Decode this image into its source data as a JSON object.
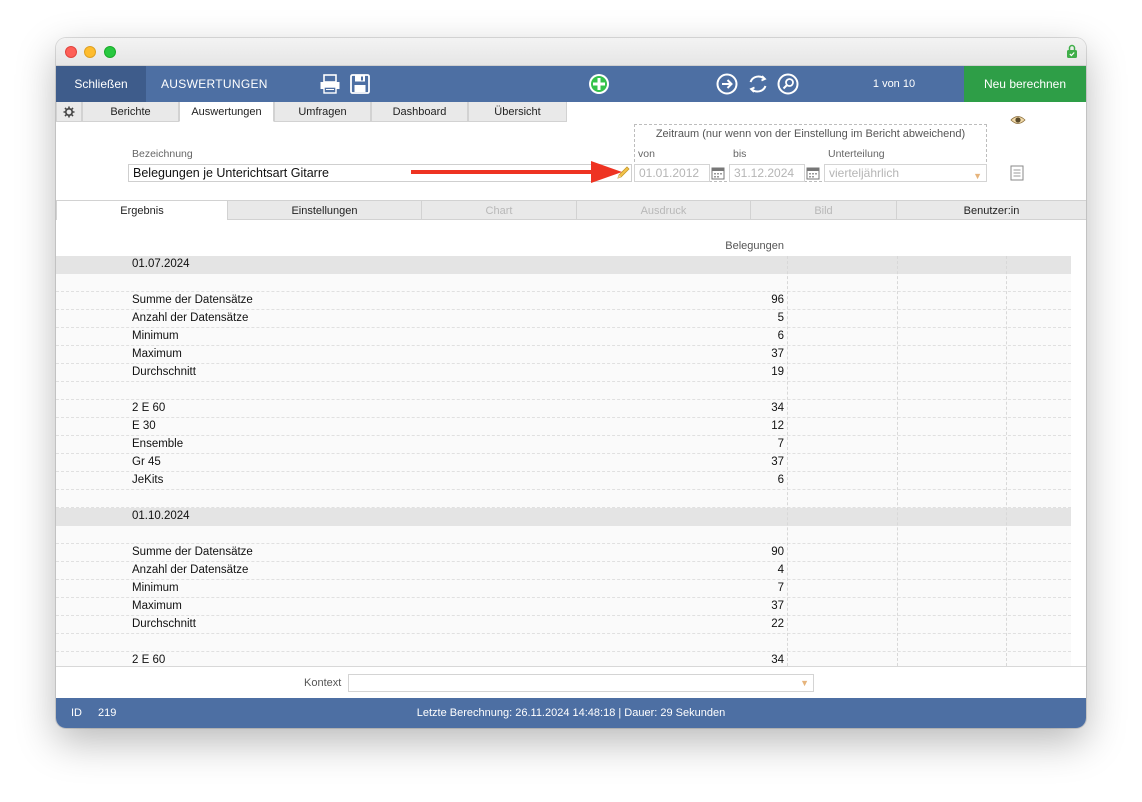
{
  "toolbar": {
    "close_label": "Schließen",
    "title": "AUSWERTUNGEN",
    "record_count": "1 von 10",
    "recalc_label": "Neu berechnen"
  },
  "top_tabs": [
    "Berichte",
    "Auswertungen",
    "Umfragen",
    "Dashboard",
    "Übersicht"
  ],
  "form": {
    "bezeichnung_label": "Bezeichnung",
    "bezeichnung_value": "Belegungen je Unterichtsart Gitarre",
    "zeitraum_label": "Zeitraum (nur wenn von der Einstellung im Bericht abweichend)",
    "von_label": "von",
    "von_value": "01.01.2012",
    "bis_label": "bis",
    "bis_value": "31.12.2024",
    "unterteilung_label": "Unterteilung",
    "unterteilung_value": "vierteljährlich"
  },
  "sub_tabs": [
    "Ergebnis",
    "Einstellungen",
    "Chart",
    "Ausdruck",
    "Bild",
    "Benutzer:in"
  ],
  "results": {
    "column_header": "Belegungen",
    "rows": [
      {
        "label": "01.07.2024",
        "value": ""
      },
      {
        "label": "",
        "value": ""
      },
      {
        "label": "Summe der Datensätze",
        "value": "96"
      },
      {
        "label": "Anzahl der Datensätze",
        "value": "5"
      },
      {
        "label": "Minimum",
        "value": "6"
      },
      {
        "label": "Maximum",
        "value": "37"
      },
      {
        "label": "Durchschnitt",
        "value": "19"
      },
      {
        "label": "",
        "value": ""
      },
      {
        "label": "2 E 60",
        "value": "34"
      },
      {
        "label": "E 30",
        "value": "12"
      },
      {
        "label": "Ensemble",
        "value": "7"
      },
      {
        "label": "Gr 45",
        "value": "37"
      },
      {
        "label": "JeKits",
        "value": "6"
      },
      {
        "label": "",
        "value": ""
      },
      {
        "label": "01.10.2024",
        "value": ""
      },
      {
        "label": "",
        "value": ""
      },
      {
        "label": "Summe der Datensätze",
        "value": "90"
      },
      {
        "label": "Anzahl der Datensätze",
        "value": "4"
      },
      {
        "label": "Minimum",
        "value": "7"
      },
      {
        "label": "Maximum",
        "value": "37"
      },
      {
        "label": "Durchschnitt",
        "value": "22"
      },
      {
        "label": "",
        "value": ""
      },
      {
        "label": "2 E 60",
        "value": "34"
      }
    ]
  },
  "context": {
    "label": "Kontext",
    "value": ""
  },
  "status": {
    "id_label": "ID",
    "id_value": "219",
    "info": "Letzte Berechnung: 26.11.2024 14:48:18  |  Dauer: 29 Sekunden"
  },
  "colors": {
    "toolbar_bg": "#4d6fa3",
    "recalc_bg": "#2e9e47",
    "arrow": "#ee3322"
  }
}
